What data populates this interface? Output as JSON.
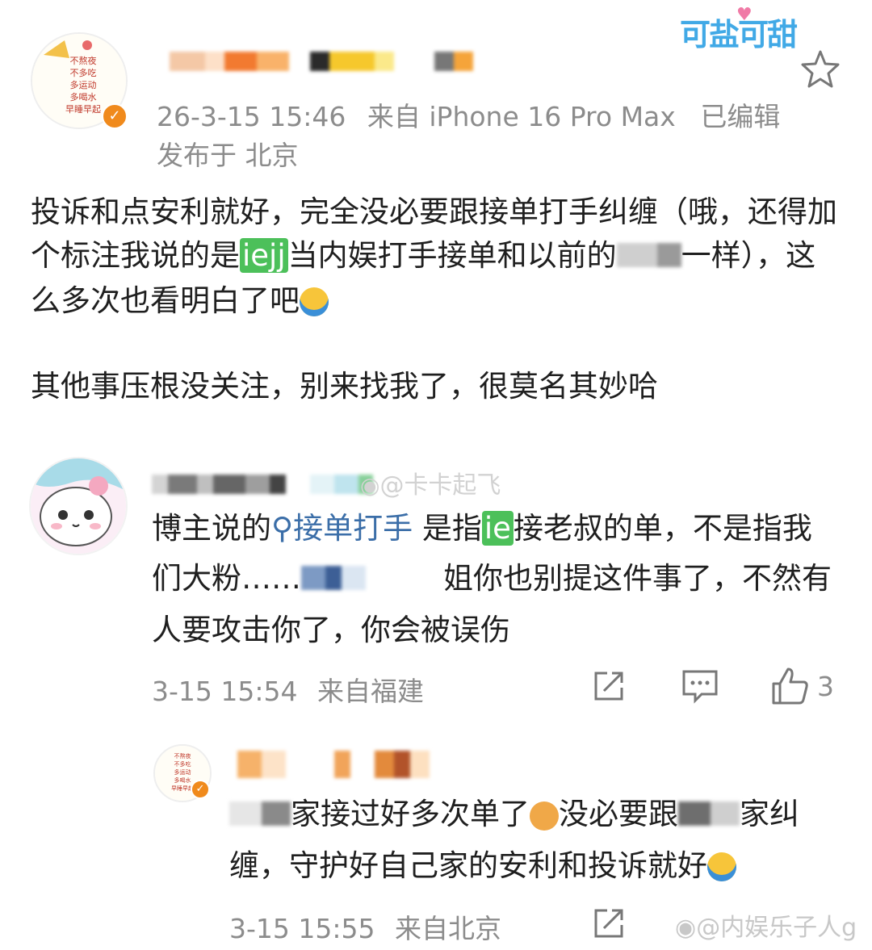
{
  "post": {
    "time": "26-3-15 15:46",
    "source": "来自 iPhone 16 Pro Max",
    "edited": "已编辑",
    "location": "发布于 北京",
    "badge_text": "可盐可甜",
    "avatar_text": [
      "不熬夜",
      "不多吃",
      "多运动",
      "多喝水",
      "早睡早起"
    ],
    "para1_a": "投诉和点安利就好，完全没必要跟接单打手纠缠（哦，还得加个标注我说的是",
    "para1_tag": "iejj",
    "para1_b": "当内娱打手接单和以前的",
    "para1_c": "一样），这么多次也看明白了吧",
    "para2": "其他事压根没关注，别来找我了，很莫名其妙哈"
  },
  "comment": {
    "watermark": "@卡卡起飞",
    "text_a": "博主说的",
    "topic": "接单打手",
    "text_b": "是指",
    "tag": "ie",
    "text_c": "接老叔的单，不是指我们大粉……",
    "text_d": "姐你也别提这件事了，不然有人要攻击你了，你会被误伤",
    "time": "3-15 15:54",
    "source": "来自福建",
    "like_count": "3"
  },
  "reply": {
    "text_a": "家接过好多次单了",
    "text_b": "没必要跟",
    "text_c": "家纠缠，守护好自己家的安利和投诉就好",
    "time": "3-15 15:55",
    "source": "来自北京",
    "watermark": "@内娱乐子人g"
  },
  "colors": {
    "vip": "#f08a1c",
    "green": "#4cc05a",
    "topic": "#3b6ea8",
    "meta": "#8c8c8c"
  },
  "icons": [
    "star-icon",
    "verified-icon",
    "share-icon",
    "comment-icon",
    "like-icon",
    "search-icon",
    "weibo-logo-icon"
  ]
}
